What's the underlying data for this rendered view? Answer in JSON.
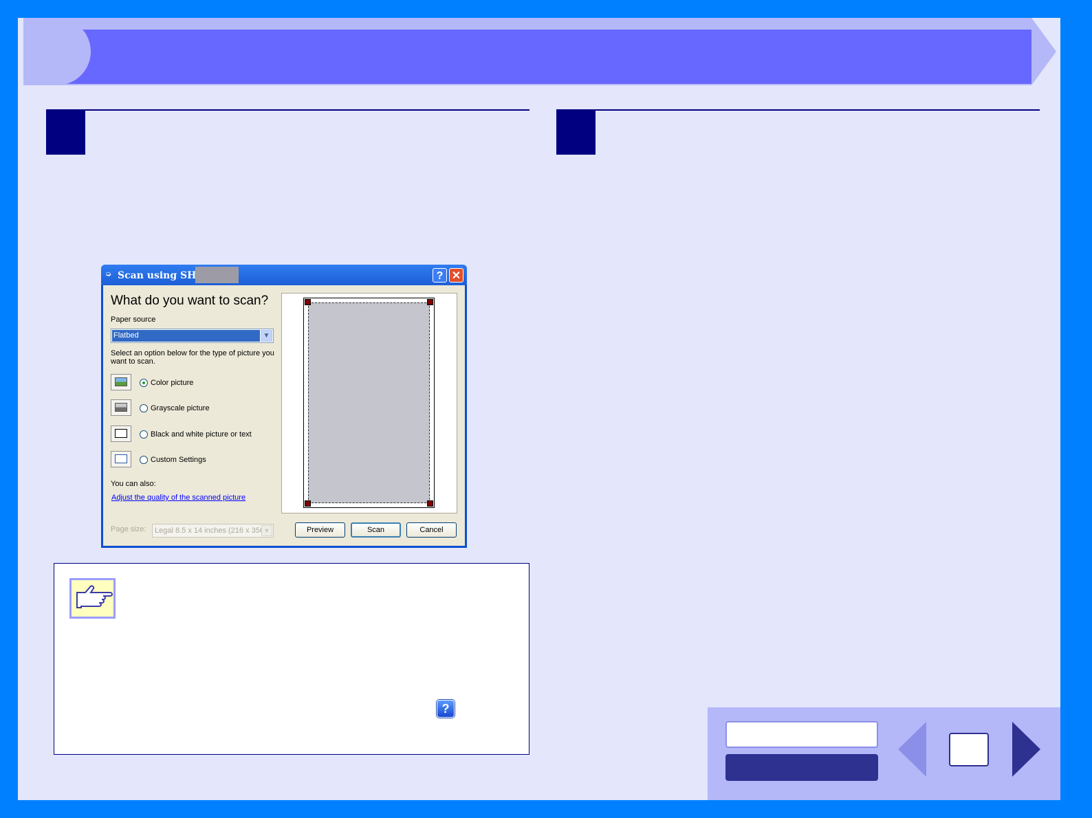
{
  "dialog": {
    "title": "Scan using SHARP",
    "help_button": "?",
    "close_button": "✕",
    "heading": "What do you want to scan?",
    "paper_source_label": "Paper source",
    "paper_source_value": "Flatbed",
    "instruction": "Select an option below for the type of picture you want to scan.",
    "options": [
      {
        "label": "Color picture",
        "selected": true
      },
      {
        "label": "Grayscale picture",
        "selected": false
      },
      {
        "label": "Black and white picture or text",
        "selected": false
      },
      {
        "label": "Custom Settings",
        "selected": false
      }
    ],
    "you_can_also": "You can also:",
    "adjust_link": "Adjust the quality of the scanned picture",
    "page_size_label": "Page size:",
    "page_size_value": "Legal 8.5 x 14 inches (216 x 356",
    "buttons": {
      "preview": "Preview",
      "scan": "Scan",
      "cancel": "Cancel"
    }
  },
  "hint": {
    "help_icon": "?"
  },
  "colors": {
    "outer_border": "#0080ff",
    "page_background": "#e4e6fb",
    "banner": "#6768ff",
    "step_box": "#000080",
    "nav_dark": "#2e3190"
  }
}
